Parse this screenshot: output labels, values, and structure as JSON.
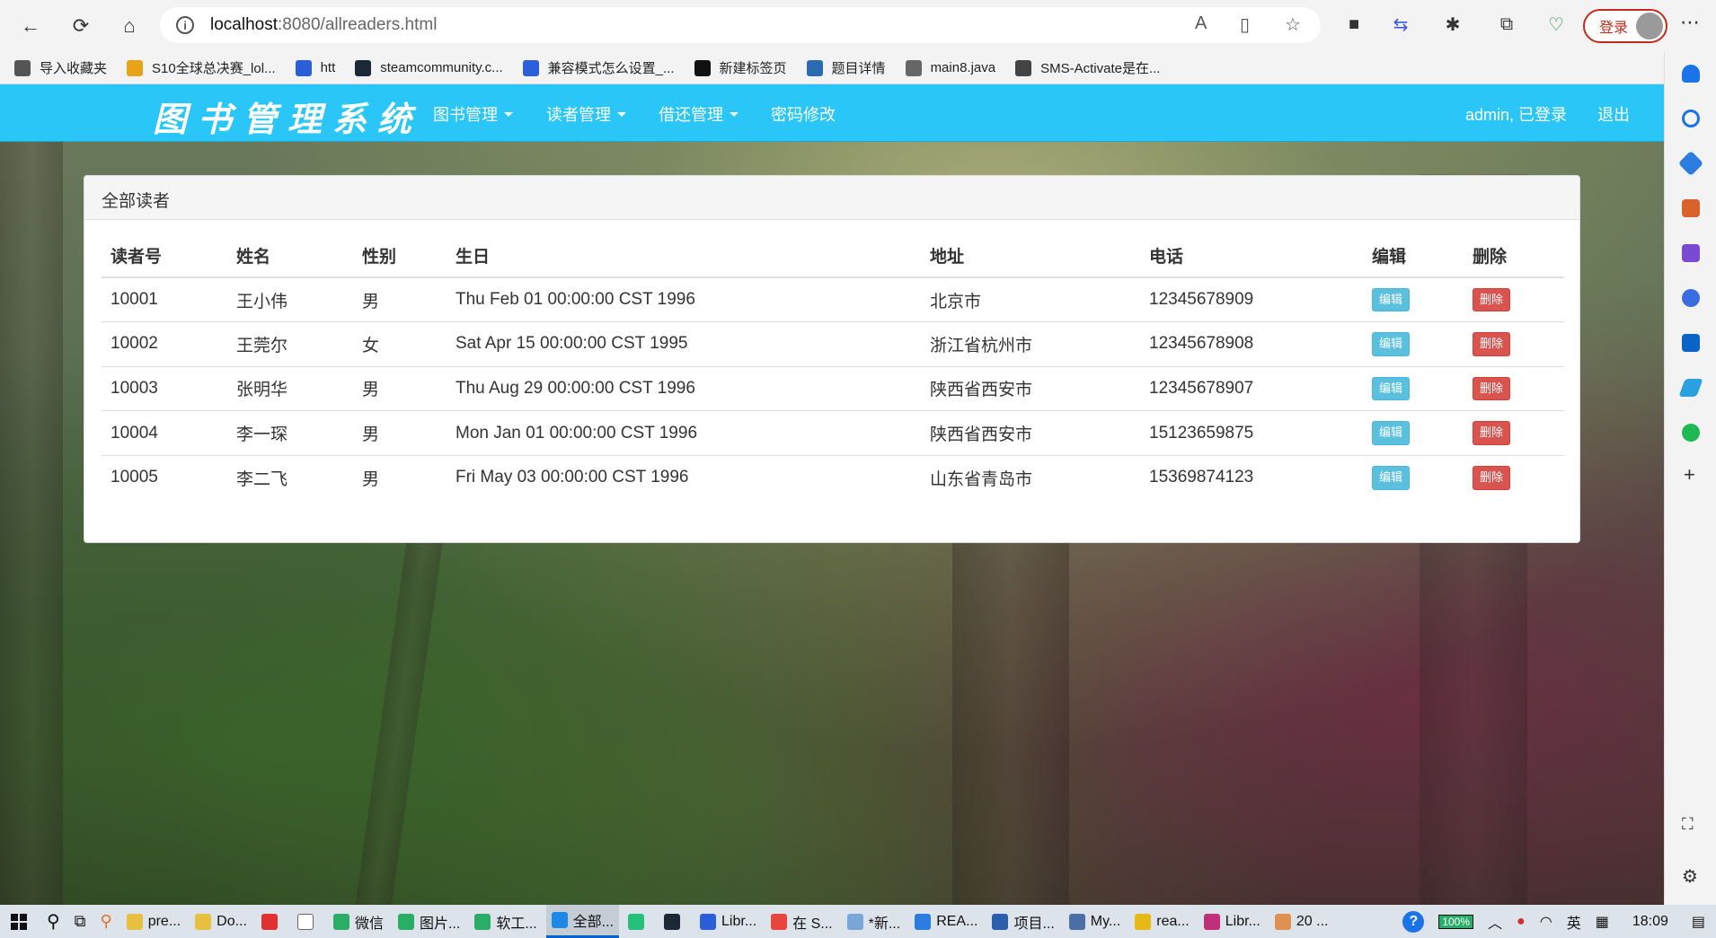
{
  "browser": {
    "url_host": "localhost",
    "url_path": ":8080/allreaders.html",
    "login_label": "登录",
    "bookmarks": [
      {
        "label": "导入收藏夹",
        "color": "#555555"
      },
      {
        "label": "S10全球总决赛_lol...",
        "color": "#e8a317"
      },
      {
        "label": "htt",
        "color": "#2b5fd9"
      },
      {
        "label": "steamcommunity.c...",
        "color": "#1b2838"
      },
      {
        "label": "兼容模式怎么设置_...",
        "color": "#2b5fd9"
      },
      {
        "label": "新建标签页",
        "color": "#111111"
      },
      {
        "label": "题目详情",
        "color": "#2b6cb0"
      },
      {
        "label": "main8.java",
        "color": "#666666"
      },
      {
        "label": "SMS-Activate是在...",
        "color": "#444444"
      }
    ]
  },
  "app": {
    "brand": "图书管理系统",
    "menu": [
      {
        "label": "图书管理",
        "dropdown": true
      },
      {
        "label": "读者管理",
        "dropdown": true
      },
      {
        "label": "借还管理",
        "dropdown": true
      },
      {
        "label": "密码修改",
        "dropdown": false
      }
    ],
    "user_status": "admin, 已登录",
    "logout": "退出"
  },
  "panel": {
    "title": "全部读者",
    "headers": [
      "读者号",
      "姓名",
      "性别",
      "生日",
      "地址",
      "电话",
      "编辑",
      "删除"
    ],
    "edit_label": "编辑",
    "delete_label": "删除",
    "rows": [
      {
        "id": "10001",
        "name": "王小伟",
        "gender": "男",
        "birthday": "Thu Feb 01 00:00:00 CST 1996",
        "address": "北京市",
        "phone": "12345678909"
      },
      {
        "id": "10002",
        "name": "王莞尔",
        "gender": "女",
        "birthday": "Sat Apr 15 00:00:00 CST 1995",
        "address": "浙江省杭州市",
        "phone": "12345678908"
      },
      {
        "id": "10003",
        "name": "张明华",
        "gender": "男",
        "birthday": "Thu Aug 29 00:00:00 CST 1996",
        "address": "陕西省西安市",
        "phone": "12345678907"
      },
      {
        "id": "10004",
        "name": "李一琛",
        "gender": "男",
        "birthday": "Mon Jan 01 00:00:00 CST 1996",
        "address": "陕西省西安市",
        "phone": "15123659875"
      },
      {
        "id": "10005",
        "name": "李二飞",
        "gender": "男",
        "birthday": "Fri May 03 00:00:00 CST 1996",
        "address": "山东省青岛市",
        "phone": "15369874123"
      }
    ]
  },
  "taskbar": {
    "apps": [
      {
        "label": "pre...",
        "color": "#e8c040"
      },
      {
        "label": "Do...",
        "color": "#e8c040"
      },
      {
        "label": "",
        "color": "#e03030"
      },
      {
        "label": "",
        "color": "#ffffff"
      },
      {
        "label": "微信",
        "color": "#2aae67"
      },
      {
        "label": "图片...",
        "color": "#2aae67"
      },
      {
        "label": "软工...",
        "color": "#2aae67"
      },
      {
        "label": "全部...",
        "color": "#1e88e5",
        "active": true
      },
      {
        "label": "",
        "color": "#25c07a"
      },
      {
        "label": "",
        "color": "#1b2838"
      },
      {
        "label": "Libr...",
        "color": "#2b5fd9"
      },
      {
        "label": "在 S...",
        "color": "#e8453c"
      },
      {
        "label": "*新...",
        "color": "#7aa7d8"
      },
      {
        "label": "REA...",
        "color": "#2b7de0"
      },
      {
        "label": "项目...",
        "color": "#2b5fad"
      },
      {
        "label": "My...",
        "color": "#4a6fa5"
      },
      {
        "label": "rea...",
        "color": "#e8b817"
      },
      {
        "label": "Libr...",
        "color": "#c0307a"
      },
      {
        "label": "20 ...",
        "color": "#e09050"
      }
    ],
    "battery": "100%",
    "ime": "英",
    "time": "18:09"
  }
}
